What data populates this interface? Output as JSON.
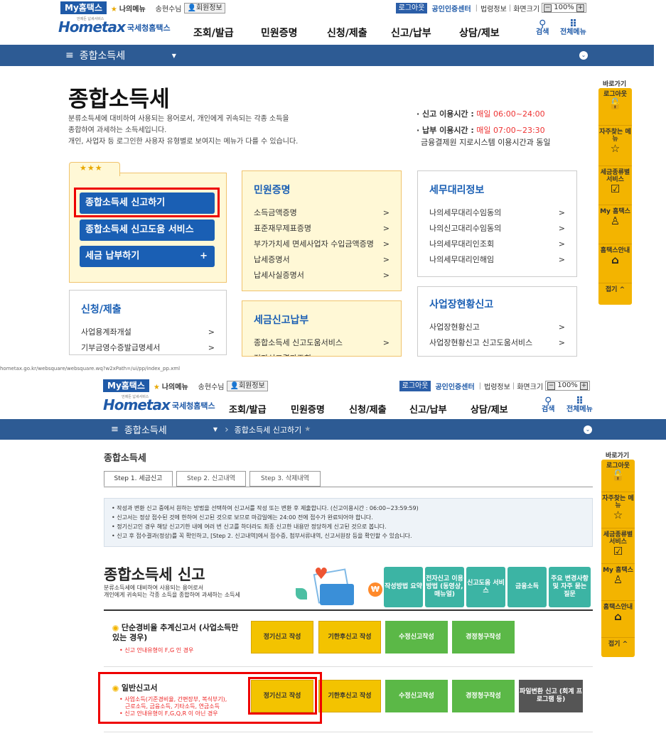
{
  "top": {
    "util": {
      "my_hometax": "My홈택스",
      "my_menu": "나의메뉴",
      "user": "송현수님",
      "member_info": "회원정보",
      "logout": "로그아웃",
      "cert_center": "공인인증센터",
      "legal": "법령정보",
      "screen_size": "화면크기",
      "zoom": "100%"
    },
    "logo": {
      "tagline": "언제든 납세서비스",
      "name": "Hometax",
      "agency": "국세청홈택스"
    },
    "gnb": [
      "조회/발급",
      "민원증명",
      "신청/제출",
      "신고/납부",
      "상담/제보"
    ],
    "search": "검색",
    "all_menu": "전체메뉴",
    "breadcrumb": "종합소득세",
    "page_title": "종합소득세",
    "desc": [
      "분류소득세에 대비하여 사용되는 용어로서, 개인에게 귀속되는 각종 소득을",
      "종합하여 과세하는 소득세입니다.",
      "개인, 사업자 등 로그인한 사용자 유형별로 보여지는 메뉴가 다를 수 있습니다."
    ],
    "hours": {
      "report_label": "· 신고 이용시간 :",
      "report_time": "매일 06:00~24:00",
      "pay_label": "· 납부 이용시간 :",
      "pay_time": "매일 07:00~23:30",
      "pay_note": "금융결제원 지로시스템 이용시간과 동일"
    },
    "stars": "★★★",
    "blue_buttons": [
      "종합소득세 신고하기",
      "종합소득세 신고도움 서비스",
      "세금 납부하기"
    ],
    "plus": "+",
    "cards": {
      "civil": {
        "title": "민원증명",
        "items": [
          "소득금액증명",
          "표준재무제표증명",
          "부가가치세 면세사업자 수입금액증명",
          "납세증명서",
          "납세사실증명서"
        ]
      },
      "tax_agent": {
        "title": "세무대리정보",
        "items": [
          "나의세무대리수임동의",
          "나의신고대리수임동의",
          "나의세무대리인조회",
          "나의세무대리인해임"
        ]
      },
      "apply": {
        "title": "신청/제출",
        "items": [
          "사업용계좌개설",
          "기부금영수증발급명세서"
        ]
      },
      "tax_report": {
        "title": "세금신고납부",
        "items": [
          "종합소득세 신고도움서비스",
          "전자신고결과조회"
        ]
      },
      "biz": {
        "title": "사업장현황신고",
        "items": [
          "사업장현황신고",
          "사업장현황신고 신고도움서비스"
        ]
      }
    },
    "chevron": ">"
  },
  "quick": {
    "title": "바로가기",
    "items": [
      "로그아웃",
      "자주찾는 메뉴",
      "세금종류별 서비스",
      "My 홈택스",
      "홈택스안내"
    ],
    "collapse": "접기"
  },
  "bottom": {
    "url": "hometax.go.kr/websquare/websquare.wq?w2xPath=/ui/pp/index_pp.xml",
    "breadcrumb": "종합소득세",
    "breadcrumb2": "종합소득세 신고하기",
    "page_title": "종합소득세",
    "tabs": [
      "Step 1. 세금신고",
      "Step 2. 신고내역",
      "Step 3. 삭제내역"
    ],
    "notices": [
      "작성과 변환 신고 중에서 원하는 방법을 선택하여 신고서를 작성 또는 변환 후 제출합니다. (신고이용시간 : 06:00~23:59:59)",
      "신고서는 정상 접수된 것에 한하여 신고된 것으로 보므로 마감일에는 24:00 전에 접수가 완료되어야 합니다.",
      "정기신고인 경우 해당 신고기한 내에 여러 번 신고를 하더라도 최종 신고한 내용만 정당하게 신고된 것으로 봅니다.",
      "신고 후 접수결과(정상)를 꼭 확인하고, [Step 2. 신고내역]에서 접수증, 첨부서류내역, 신고서원장 등을 확인할 수 있습니다."
    ],
    "hero_title": "종합소득세 신고",
    "hero_desc": [
      "분류소득세에 대비하여 사용되는 용어로서",
      "개인에게 귀속되는 각종 소득을 종합하여 과세하는 소득세"
    ],
    "hero_buttons": [
      "작성방법 요약",
      "전자신고 이용방법 (동영상, 매뉴얼)",
      "신고도움 서비스",
      "금융소득",
      "주요 변경사항 및 자주 묻는 질문"
    ],
    "simple": {
      "title": "단순경비율 추계신고서 (사업소득만 있는 경우)",
      "note": "• 신고 안내유형이 F,G 인 경우"
    },
    "general": {
      "title": "일반신고서",
      "note": [
        "• 사업소득(기준경비율, 간편장부, 복식부기),",
        "근로소득, 금융소득, 기타소득, 연금소득",
        "• 신고 안내유형이 F,G,Q,R 이 아닌 경우"
      ]
    },
    "row_buttons": [
      "정기신고 작성",
      "기한후신고 작성",
      "수정신고작성",
      "경정청구작성"
    ],
    "convert_button": "파일변환 신고 (회계 프로그램 등)"
  }
}
